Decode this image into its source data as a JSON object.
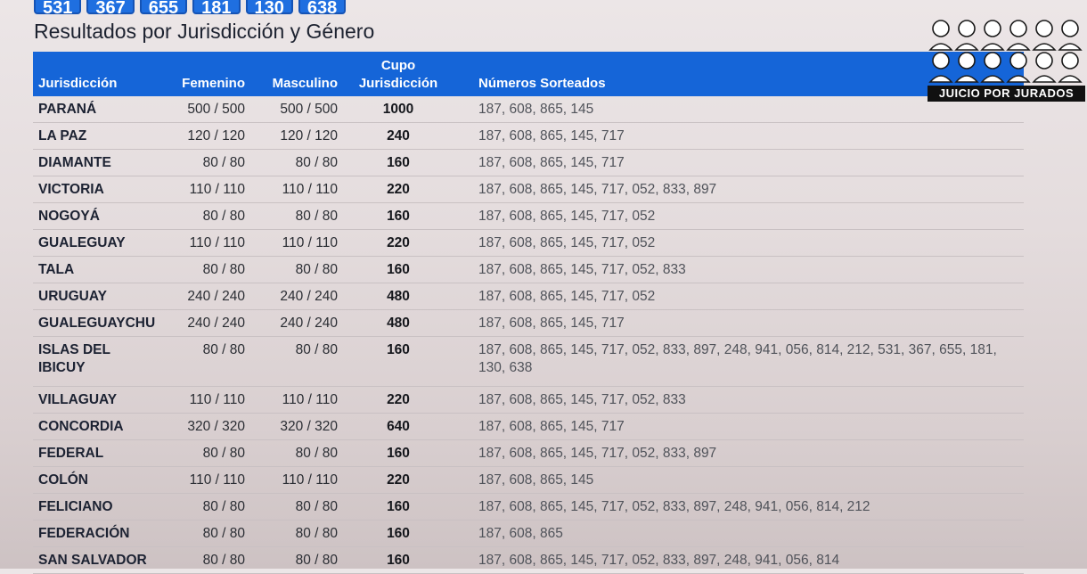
{
  "chips": [
    "531",
    "367",
    "655",
    "181",
    "130",
    "638"
  ],
  "title": "Resultados por Jurisdicción y Género",
  "headers": {
    "jurisdiccion": "Jurisdicción",
    "femenino": "Femenino",
    "masculino": "Masculino",
    "cupo_line1": "Cupo",
    "cupo_line2": "Jurisdicción",
    "numeros": "Números Sorteados"
  },
  "rows": [
    {
      "j": "PARANÁ",
      "f": "500 / 500",
      "m": "500 / 500",
      "c": "1000",
      "n": "187, 608, 865, 145"
    },
    {
      "j": "LA PAZ",
      "f": "120 / 120",
      "m": "120 / 120",
      "c": "240",
      "n": "187, 608, 865, 145, 717"
    },
    {
      "j": "DIAMANTE",
      "f": "80 / 80",
      "m": "80 / 80",
      "c": "160",
      "n": "187, 608, 865, 145, 717"
    },
    {
      "j": "VICTORIA",
      "f": "110 / 110",
      "m": "110 / 110",
      "c": "220",
      "n": "187, 608, 865, 145, 717, 052, 833, 897"
    },
    {
      "j": "NOGOYÁ",
      "f": "80 / 80",
      "m": "80 / 80",
      "c": "160",
      "n": "187, 608, 865, 145, 717, 052"
    },
    {
      "j": "GUALEGUAY",
      "f": "110 / 110",
      "m": "110 / 110",
      "c": "220",
      "n": "187, 608, 865, 145, 717, 052"
    },
    {
      "j": "TALA",
      "f": "80 / 80",
      "m": "80 / 80",
      "c": "160",
      "n": "187, 608, 865, 145, 717, 052, 833"
    },
    {
      "j": "URUGUAY",
      "f": "240 / 240",
      "m": "240 / 240",
      "c": "480",
      "n": "187, 608, 865, 145, 717, 052"
    },
    {
      "j": "GUALEGUAYCHU",
      "f": "240 / 240",
      "m": "240 / 240",
      "c": "480",
      "n": "187, 608, 865, 145, 717"
    },
    {
      "j": "ISLAS DEL IBICUY",
      "f": "80 / 80",
      "m": "80 / 80",
      "c": "160",
      "n": "187, 608, 865, 145, 717, 052, 833, 897, 248, 941, 056, 814, 212, 531, 367, 655, 181, 130, 638"
    },
    {
      "j": "VILLAGUAY",
      "f": "110 / 110",
      "m": "110 / 110",
      "c": "220",
      "n": "187, 608, 865, 145, 717, 052, 833"
    },
    {
      "j": "CONCORDIA",
      "f": "320 / 320",
      "m": "320 / 320",
      "c": "640",
      "n": "187, 608, 865, 145, 717"
    },
    {
      "j": "FEDERAL",
      "f": "80 / 80",
      "m": "80 / 80",
      "c": "160",
      "n": "187, 608, 865, 145, 717, 052, 833, 897"
    },
    {
      "j": "COLÓN",
      "f": "110 / 110",
      "m": "110 / 110",
      "c": "220",
      "n": "187, 608, 865, 145"
    },
    {
      "j": "FELICIANO",
      "f": "80 / 80",
      "m": "80 / 80",
      "c": "160",
      "n": "187, 608, 865, 145, 717, 052, 833, 897, 248, 941, 056, 814, 212"
    },
    {
      "j": "FEDERACIÓN",
      "f": "80 / 80",
      "m": "80 / 80",
      "c": "160",
      "n": "187, 608, 865"
    },
    {
      "j": "SAN SALVADOR",
      "f": "80 / 80",
      "m": "80 / 80",
      "c": "160",
      "n": "187, 608, 865, 145, 717, 052, 833, 897, 248, 941, 056, 814"
    }
  ],
  "logo": {
    "text": "JUICIO POR JURADOS"
  },
  "colors": {
    "header_blue": "#1565d8",
    "chip_blue": "#1f6fe0",
    "background": "#e4dcdd"
  }
}
